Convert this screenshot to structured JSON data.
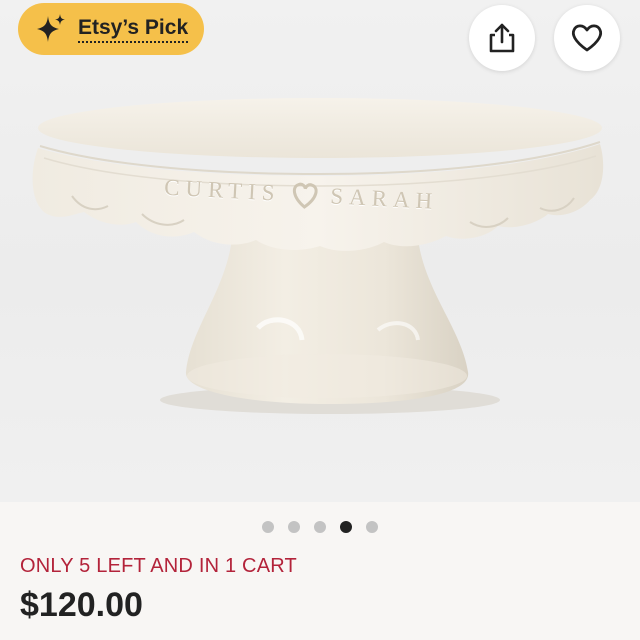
{
  "badge": {
    "label": "Etsy’s Pick",
    "icon": "sparkle-icon",
    "color": "#f5c04a"
  },
  "actions": {
    "share_icon": "share-icon",
    "favorite_icon": "heart-icon"
  },
  "product_image": {
    "engraving_left": "CURTIS",
    "engraving_right": "SARAH",
    "engraving_icon": "heart-icon"
  },
  "carousel": {
    "total": 5,
    "active_index": 3
  },
  "listing": {
    "stock_notice": "ONLY 5 LEFT AND IN 1 CART",
    "price": "$120.00"
  },
  "colors": {
    "stock_notice": "#b3233a",
    "price": "#222222"
  }
}
